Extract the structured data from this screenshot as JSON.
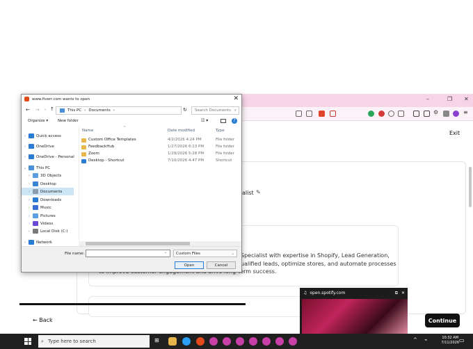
{
  "browser": {
    "exit_label": "Exit",
    "name_fragment": "alist",
    "description_lines": [
      "Specialist with expertise in Shopify, Lead Generation,",
      "ualified leads, optimize stores, and automate processes",
      "to improve customer engagement and drive long-term success."
    ],
    "back_label": "← Back",
    "continue_label": "Continue"
  },
  "spotify": {
    "title": "open.spotify.com"
  },
  "taskbar": {
    "search_placeholder": "Type here to search",
    "time": "10:32 AM",
    "date": "7/11/2026"
  },
  "dialog": {
    "title": "www.fiverr.com wants to open",
    "address": [
      "This PC",
      "Documents"
    ],
    "search_placeholder": "Search Documents",
    "organize_label": "Organize ▾",
    "new_folder_label": "New folder",
    "nav_items": [
      {
        "label": "Quick access",
        "color": "#2a7bd4"
      },
      {
        "label": "OneDrive",
        "color": "#2a7bd4"
      },
      {
        "label": "OneDrive - Personal",
        "color": "#2a7bd4"
      },
      {
        "label": "This PC",
        "color": "#4a90d9"
      },
      {
        "label": "3D Objects",
        "color": "#5aa0e0"
      },
      {
        "label": "Desktop",
        "color": "#3a86d6"
      },
      {
        "label": "Documents",
        "color": "#8a9bb0"
      },
      {
        "label": "Downloads",
        "color": "#2a7bd4"
      },
      {
        "label": "Music",
        "color": "#3a6fd6"
      },
      {
        "label": "Pictures",
        "color": "#5aa0e0"
      },
      {
        "label": "Videos",
        "color": "#6b4bd6"
      },
      {
        "label": "Local Disk (C:)",
        "color": "#7a7a7a"
      },
      {
        "label": "Network",
        "color": "#2a7bd4"
      }
    ],
    "columns": {
      "name": "Name",
      "date": "Date modified",
      "type": "Type"
    },
    "files": [
      {
        "name": "Custom Office Templates",
        "date": "4/2/2026 4:24 PM",
        "type": "File folder",
        "icon": "folder-icon"
      },
      {
        "name": "FeedbackHub",
        "date": "1/27/2026 6:13 PM",
        "type": "File folder",
        "icon": "folder-icon"
      },
      {
        "name": "Zoom",
        "date": "1/29/2026 5:28 PM",
        "type": "File folder",
        "icon": "folder-icon"
      },
      {
        "name": "Desktop - Shortcut",
        "date": "7/10/2026 4:47 PM",
        "type": "Shortcut",
        "icon": "shortcut-icon"
      }
    ],
    "file_name_label": "File name:",
    "file_name_value": "",
    "filter_value": "Custom Files",
    "open_label": "Open",
    "cancel_label": "Cancel"
  }
}
